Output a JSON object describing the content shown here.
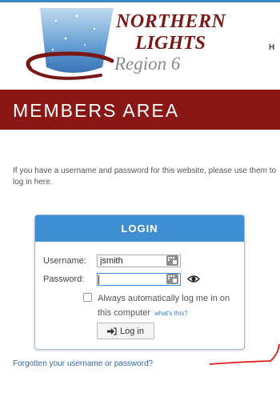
{
  "header": {
    "logo": {
      "line1": "NORTHERN",
      "line2": "LIGHTS",
      "line3": "Region 6"
    },
    "cut_nav_text": "H"
  },
  "banner": {
    "title": "MEMBERS AREA"
  },
  "intro_text": "If you have a username and password for this website, please use them to log in here.",
  "login": {
    "title": "LOGIN",
    "username_label": "Username:",
    "username_value": "jsmith",
    "password_label": "Password:",
    "password_value": "",
    "remember_label": "Always automatically log me in on this computer",
    "remember_checked": false,
    "whats_this": "what's this?",
    "submit_label": "Log in"
  },
  "forgot_link": "Forgotten your username or password?",
  "icons": {
    "keyboard": "virtual-keyboard-icon",
    "eye": "show-password-icon",
    "login": "sign-in-arrow-icon"
  },
  "colors": {
    "banner": "#8a1616",
    "login_header": "#3f8ed1",
    "link": "#2f67a8",
    "annotation": "#e21a1a"
  }
}
